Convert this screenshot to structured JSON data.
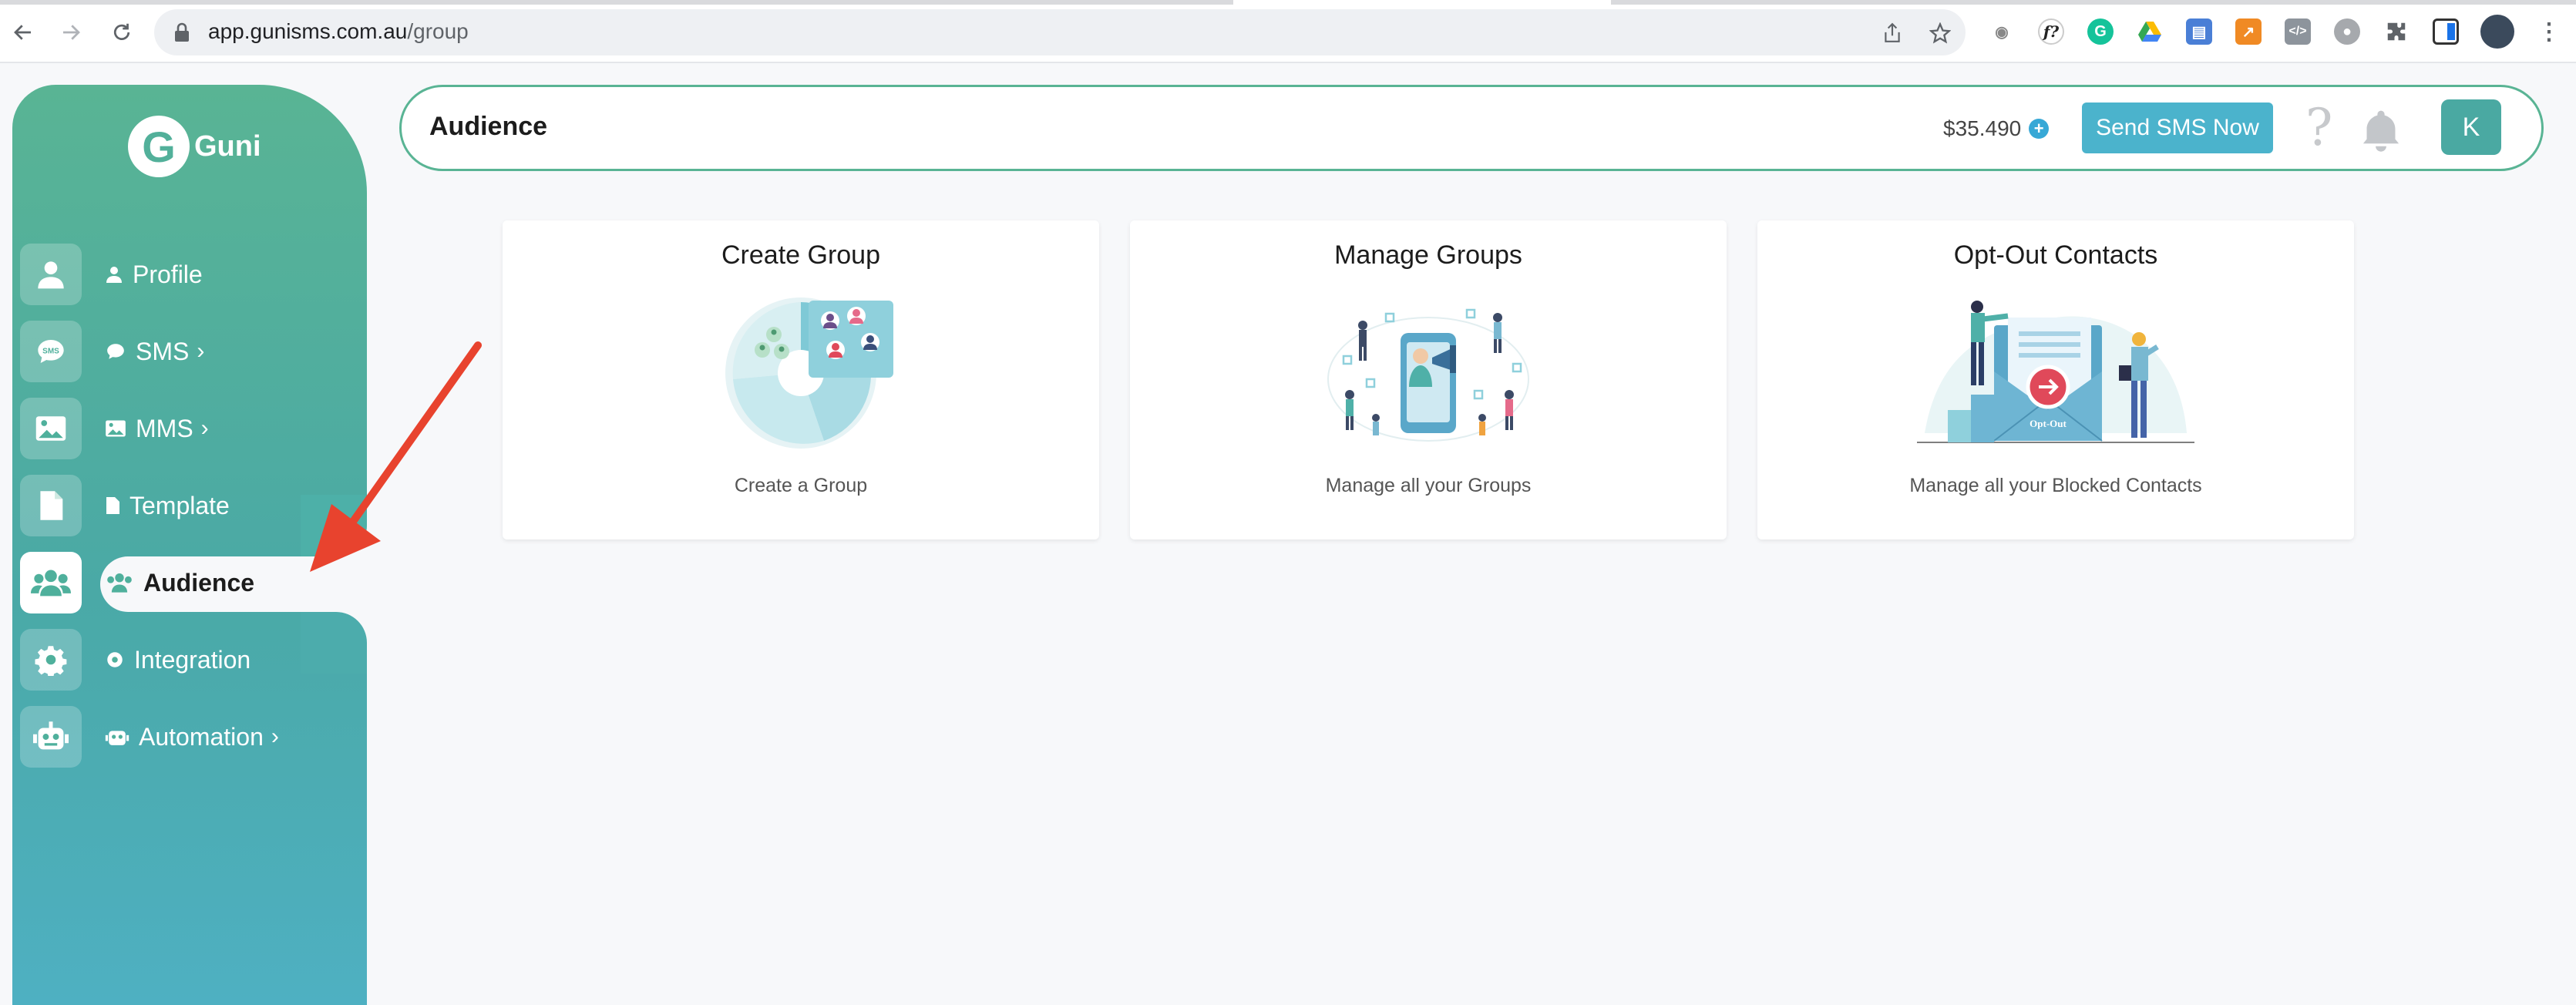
{
  "browser": {
    "url_host": "app.gunisms.com.au",
    "url_path": "/group"
  },
  "brand": {
    "logo_letter": "G",
    "name": "Guni"
  },
  "sidebar": {
    "items": [
      {
        "label": "Profile",
        "icon": "user-icon",
        "has_chevron": false
      },
      {
        "label": "SMS",
        "icon": "sms-icon",
        "has_chevron": true
      },
      {
        "label": "MMS",
        "icon": "image-icon",
        "has_chevron": true
      },
      {
        "label": "Template",
        "icon": "file-icon",
        "has_chevron": false
      },
      {
        "label": "Audience",
        "icon": "users-icon",
        "has_chevron": false,
        "active": true
      },
      {
        "label": "Integration",
        "icon": "gear-icon",
        "has_chevron": false
      },
      {
        "label": "Automation",
        "icon": "robot-icon",
        "has_chevron": true
      }
    ],
    "chevron": "›"
  },
  "header": {
    "title": "Audience",
    "balance": "$35.490",
    "send_button": "Send SMS Now",
    "help": "?",
    "avatar_initial": "K"
  },
  "cards": [
    {
      "title": "Create Group",
      "description": "Create a Group",
      "illustration": "group-pie-illustration"
    },
    {
      "title": "Manage Groups",
      "description": "Manage all your Groups",
      "illustration": "megaphone-people-illustration"
    },
    {
      "title": "Opt-Out Contacts",
      "description": "Manage all your Blocked Contacts",
      "illustration": "opt-out-envelope-illustration",
      "badge": "Opt-Out"
    }
  ],
  "colors": {
    "sidebar_top": "#59b494",
    "sidebar_bottom": "#4eb0c2",
    "accent": "#4bb3cc",
    "arrow": "#e8432e"
  }
}
